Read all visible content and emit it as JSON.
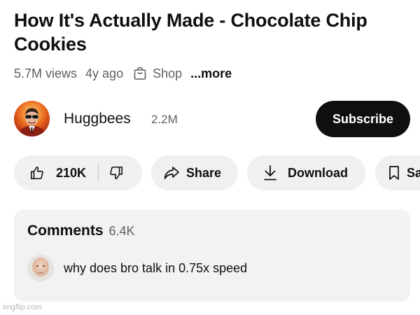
{
  "video": {
    "title": "How It's Actually Made - Chocolate Chip Cookies",
    "views": "5.7M views",
    "age": "4y ago",
    "shop_label": "Shop",
    "more_label": "...more"
  },
  "channel": {
    "name": "Huggbees",
    "subscribers": "2.2M",
    "subscribe_label": "Subscribe"
  },
  "actions": {
    "like_count": "210K",
    "share_label": "Share",
    "download_label": "Download",
    "save_label": "Save"
  },
  "comments": {
    "title": "Comments",
    "count": "6.4K",
    "top_comment": "why does bro talk in 0.75x speed"
  },
  "watermark": "imgflip.com",
  "colors": {
    "text_primary": "#0f0f0f",
    "text_secondary": "#606060",
    "pill_background": "#f0f0f0",
    "subscribe_background": "#0f0f0f",
    "comments_background": "#f2f2f2"
  },
  "icons": [
    "shopping-bag-icon",
    "thumbs-up-icon",
    "thumbs-down-icon",
    "share-arrow-icon",
    "download-icon",
    "bookmark-icon"
  ]
}
